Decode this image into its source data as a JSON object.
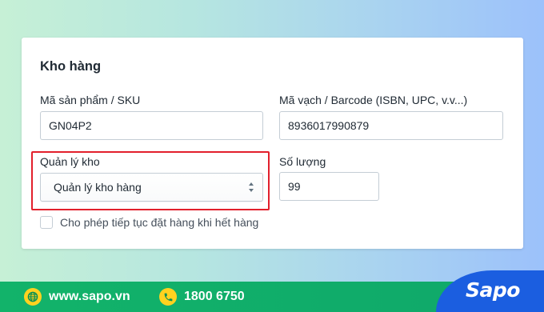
{
  "inventory": {
    "section_title": "Kho hàng",
    "sku_label": "Mã sản phẩm / SKU",
    "sku_value": "GN04P2",
    "barcode_label": "Mã vạch / Barcode (ISBN, UPC, v.v...)",
    "barcode_value": "8936017990879",
    "manage_label": "Quản lý kho",
    "manage_value": "Quản lý kho hàng",
    "quantity_label": "Số lượng",
    "quantity_value": "99",
    "backorder_label": "Cho phép tiếp tục đặt hàng khi hết hàng",
    "backorder_checked": false
  },
  "footer": {
    "website": "www.sapo.vn",
    "phone": "1800 6750",
    "brand": "Sapo",
    "icons": [
      "globe-icon",
      "phone-icon"
    ]
  },
  "colors": {
    "highlight": "#e2202c",
    "footer_green": "#12b36a",
    "brand_blue": "#1b5ee0",
    "icon_yellow": "#ffd21f"
  }
}
